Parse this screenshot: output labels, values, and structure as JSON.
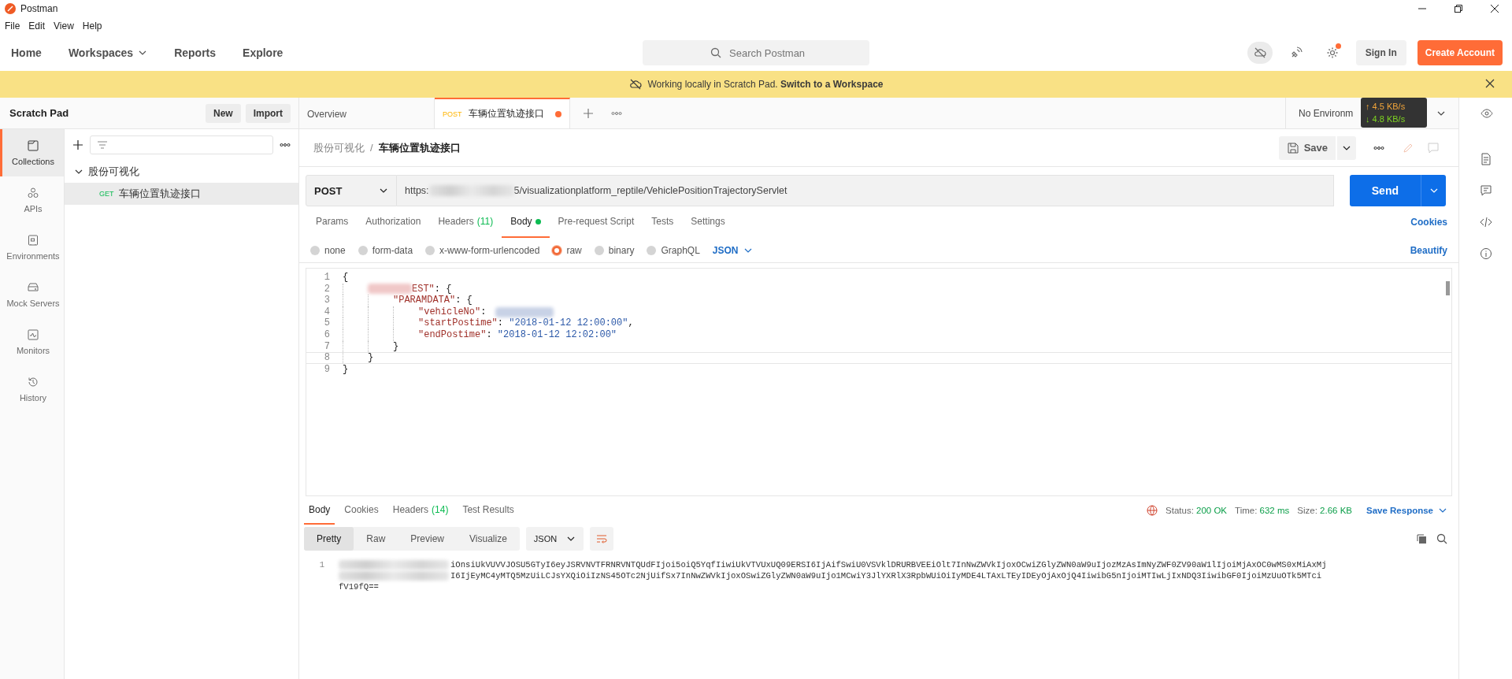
{
  "window": {
    "title": "Postman"
  },
  "menu": [
    "File",
    "Edit",
    "View",
    "Help"
  ],
  "nav": {
    "items": [
      {
        "label": "Home",
        "dropdown": false
      },
      {
        "label": "Workspaces",
        "dropdown": true
      },
      {
        "label": "Reports",
        "dropdown": false
      },
      {
        "label": "Explore",
        "dropdown": false
      }
    ],
    "search": {
      "placeholder": "Search Postman"
    },
    "settings_badge": true,
    "sign_in": "Sign In",
    "create_account": "Create Account"
  },
  "banner": {
    "text": "Working locally in Scratch Pad.",
    "link": "Switch to a Workspace"
  },
  "scratch_pad": {
    "title": "Scratch Pad",
    "buttons": [
      "New",
      "Import"
    ]
  },
  "sidebar": {
    "items": [
      {
        "kind": "collections",
        "label": "Collections",
        "selected": true
      },
      {
        "kind": "apis",
        "label": "APIs",
        "selected": false
      },
      {
        "kind": "environments",
        "label": "Environments",
        "selected": false
      },
      {
        "kind": "mock",
        "label": "Mock Servers",
        "selected": false
      },
      {
        "kind": "monitors",
        "label": "Monitors",
        "selected": false
      },
      {
        "kind": "history",
        "label": "History",
        "selected": false
      }
    ]
  },
  "collections": {
    "tree": [
      {
        "label": "股份可视化",
        "expanded": true,
        "children": [
          {
            "method": "GET",
            "label": "车辆位置轨迹接口",
            "selected": true
          }
        ]
      }
    ]
  },
  "tabs": [
    {
      "label": "Overview",
      "selected": false,
      "unsaved": false
    },
    {
      "method": "POST",
      "label": "车辆位置轨迹接口",
      "selected": true,
      "unsaved": true
    }
  ],
  "environment": "No Environm",
  "network_meter": {
    "upload": "↑ 4.5 KB/s",
    "download": "↓ 4.8 KB/s"
  },
  "breadcrumb": [
    "股份可视化",
    "车辆位置轨迹接口"
  ],
  "breadcrumb_separator": "/",
  "save": "Save",
  "request": {
    "method": "POST",
    "url_start": "https:",
    "url_end": "5/visualizationplatform_reptile/VehiclePositionTrajectoryServlet",
    "send": "Send"
  },
  "request_tabs": [
    {
      "label": "Params",
      "selected": false,
      "dot": false
    },
    {
      "label": "Authorization",
      "selected": false,
      "dot": false
    },
    {
      "label": "Headers",
      "count": "(11)",
      "selected": false,
      "dot": false
    },
    {
      "label": "Body",
      "selected": true,
      "dot": true
    },
    {
      "label": "Pre-request Script",
      "selected": false,
      "dot": false
    },
    {
      "label": "Tests",
      "selected": false,
      "dot": false
    },
    {
      "label": "Settings",
      "selected": false,
      "dot": false
    }
  ],
  "cookies": "Cookies",
  "body_types": [
    {
      "label": "none",
      "selected": false
    },
    {
      "label": "form-data",
      "selected": false
    },
    {
      "label": "x-www-form-urlencoded",
      "selected": false
    },
    {
      "label": "raw",
      "selected": true
    },
    {
      "label": "binary",
      "selected": false
    },
    {
      "label": "GraphQL",
      "selected": false
    }
  ],
  "body_format": "JSON",
  "beautify": "Beautify",
  "editor": {
    "lines": [
      {
        "number": "1",
        "redacted": false,
        "active": false,
        "tokens": [
          {
            "kind": "punct",
            "text": "{"
          }
        ],
        "children": [
          {
            "number": "2",
            "redacted": true,
            "active": false,
            "tokens": [
              {
                "kind": "key",
                "text": "EST\""
              },
              {
                "kind": "punct",
                "text": ": {"
              }
            ],
            "children": [
              {
                "number": "3",
                "redacted": false,
                "active": false,
                "tokens": [
                  {
                    "kind": "key",
                    "text": "\"PARAMDATA\""
                  },
                  {
                    "kind": "punct",
                    "text": ": {"
                  }
                ],
                "children": [
                  {
                    "number": "4",
                    "redacted": false,
                    "active": false,
                    "tokens": [
                      {
                        "kind": "key",
                        "text": "\"vehicleNo\""
                      },
                      {
                        "kind": "punct",
                        "text": ": "
                      },
                      {
                        "kind": "redacted"
                      }
                    ]
                  },
                  {
                    "number": "5",
                    "redacted": false,
                    "active": false,
                    "tokens": [
                      {
                        "kind": "key",
                        "text": "\"startPostime\""
                      },
                      {
                        "kind": "punct",
                        "text": ": "
                      },
                      {
                        "kind": "string",
                        "text": "\"2018-01-12 12:00:00\""
                      },
                      {
                        "kind": "punct",
                        "text": ","
                      }
                    ]
                  },
                  {
                    "number": "6",
                    "redacted": false,
                    "active": false,
                    "tokens": [
                      {
                        "kind": "key",
                        "text": "\"endPostime\""
                      },
                      {
                        "kind": "punct",
                        "text": ": "
                      },
                      {
                        "kind": "string",
                        "text": "\"2018-01-12 12:02:00\""
                      }
                    ]
                  }
                ]
              },
              {
                "number": "7",
                "redacted": false,
                "active": false,
                "tokens": [
                  {
                    "kind": "punct",
                    "text": "}"
                  }
                ]
              }
            ]
          },
          {
            "number": "8",
            "redacted": false,
            "active": true,
            "tokens": [
              {
                "kind": "punct",
                "text": "}"
              }
            ]
          }
        ]
      },
      {
        "number": "9",
        "redacted": false,
        "active": false,
        "tokens": [
          {
            "kind": "punct",
            "text": "}"
          }
        ]
      }
    ]
  },
  "response": {
    "tabs": [
      {
        "label": "Body",
        "selected": true
      },
      {
        "label": "Cookies",
        "selected": false
      },
      {
        "label": "Headers",
        "count": "(14)",
        "selected": false
      },
      {
        "label": "Test Results",
        "selected": false
      }
    ],
    "status_label": "Status:",
    "status": "200 OK",
    "time_label": "Time:",
    "time": "632 ms",
    "size_label": "Size:",
    "size": "2.66 KB",
    "save_response": "Save Response",
    "views": [
      {
        "label": "Pretty",
        "selected": true
      },
      {
        "label": "Raw",
        "selected": false
      },
      {
        "label": "Preview",
        "selected": false
      },
      {
        "label": "Visualize",
        "selected": false
      }
    ],
    "format": "JSON",
    "body": {
      "number": "1",
      "lines": [
        {
          "redacted": true,
          "text": "iOnsiUkVUVVJOSU5GTyI6eyJSRVNVTFRNRVNTQUdFIjoi5oiQ5YqfIiwiUkVTVUxUQ09ERSI6IjAifSwiU0VSVklDRURBVEEiOlt7InNwZWVkIjoxOCwiZGlyZWN0aW9uIjozMzAsImNyZWF0ZV90aW1lIjoiMjAxOC0wMS0xMiAxMj"
        },
        {
          "redacted": true,
          "text": "I6IjEyMC4yMTQ5MzUiLCJsYXQiOiIzNS45OTc2NjUifSx7InNwZWVkIjoxOSwiZGlyZWN0aW9uIjo1MCwiY3JlYXRlX3RpbWUiOiIyMDE4LTAxLTEyIDEyOjAxOjQ4IiwibG5nIjoiMTIwLjIxNDQ3IiwibGF0IjoiMzUuOTk5MTci"
        },
        {
          "redacted": false,
          "text": "fV19fQ=="
        }
      ]
    }
  }
}
